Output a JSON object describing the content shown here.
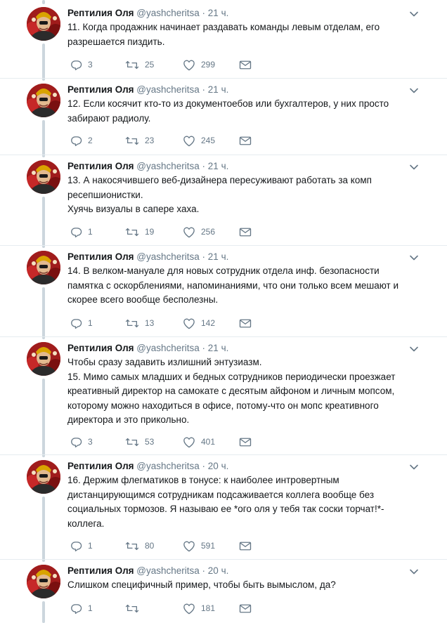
{
  "author": {
    "name": "Рептилия Оля",
    "handle": "@yashcheritsa"
  },
  "colors": {
    "text": "#14171a",
    "muted": "#657786",
    "thread_line": "#ccd6dd",
    "avatar_bg": "#b22222"
  },
  "tweets": [
    {
      "time": "21 ч.",
      "lines": [
        "11. Когда продажник начинает раздавать команды левым отделам, его",
        "разрешается пиздить."
      ],
      "replies": "3",
      "retweets": "25",
      "likes": "299"
    },
    {
      "time": "21 ч.",
      "lines": [
        "12. Если косячит кто-то из документоебов или бухгалтеров, у них просто",
        "забирают радиолу."
      ],
      "replies": "2",
      "retweets": "23",
      "likes": "245"
    },
    {
      "time": "21 ч.",
      "lines": [
        "13. А накосячившего веб-дизайнера пересуживают работать за комп",
        "ресепшионистки.",
        "Хуячь визуалы в сапере хаха."
      ],
      "replies": "1",
      "retweets": "19",
      "likes": "256"
    },
    {
      "time": "21 ч.",
      "lines": [
        "14. В велком-мануале для новых сотрудник отдела инф. безопасности",
        "памятка с оскорблениями, напоминаниями, что они только всем мешают и",
        "скорее всего вообще бесполезны."
      ],
      "replies": "1",
      "retweets": "13",
      "likes": "142"
    },
    {
      "time": "21 ч.",
      "lines": [
        "Чтобы сразу задавить излишний энтузиазм.",
        "15. Мимо самых младших и бедных сотрудников периодически проезжает",
        "креативный директор на самокате с десятым айфоном и личным мопсом,",
        "которому можно находиться в офисе, потому-что он мопс креативного",
        "директора и это прикольно."
      ],
      "replies": "3",
      "retweets": "53",
      "likes": "401"
    },
    {
      "time": "20 ч.",
      "lines": [
        "16. Держим флегматиков в тонусе: к наиболее интровертным",
        "дистанцирующимся сотрудникам подсаживается коллега вообще без",
        "социальных тормозов. Я называю ее *ого оля у тебя так соски торчат!*-",
        "коллега."
      ],
      "replies": "1",
      "retweets": "80",
      "likes": "591"
    },
    {
      "time": "20 ч.",
      "lines": [
        "Слишком специфичный пример, чтобы быть вымыслом, да?"
      ],
      "replies": "1",
      "retweets": "",
      "likes": "181"
    }
  ]
}
